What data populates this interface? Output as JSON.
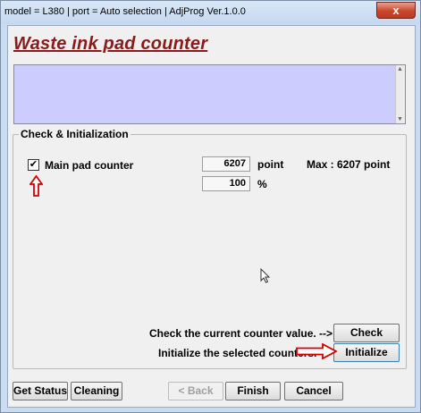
{
  "window": {
    "title": "model = L380 | port = Auto selection | AdjProg Ver.1.0.0",
    "close_glyph": "x"
  },
  "page": {
    "heading": "Waste ink pad counter"
  },
  "group": {
    "label": "Check & Initialization",
    "checkbox_checked": true,
    "checkbox_glyph": "✔",
    "checkbox_label": "Main pad counter",
    "point_value": "6207",
    "point_unit": "point",
    "max_label": "Max : 6207 point",
    "percent_value": "100",
    "percent_unit": "%"
  },
  "actions": {
    "check_prompt": "Check the current counter value. -->",
    "check_button": "Check",
    "init_prompt": "Initialize the selected counters. -->",
    "init_button": "Initialize"
  },
  "footer": {
    "get_status": "Get Status",
    "cleaning": "Cleaning",
    "back": "< Back",
    "finish": "Finish",
    "cancel": "Cancel"
  },
  "colors": {
    "heading": "#8b1a1a",
    "info_box": "#ccccff",
    "annotation_arrow": "#d40000"
  },
  "icons": {
    "scroll_up": "scroll-up-icon",
    "scroll_down": "scroll-down-icon",
    "annotation_up": "red-up-arrow-icon",
    "annotation_right": "red-right-arrow-icon",
    "cursor": "mouse-pointer-icon"
  }
}
